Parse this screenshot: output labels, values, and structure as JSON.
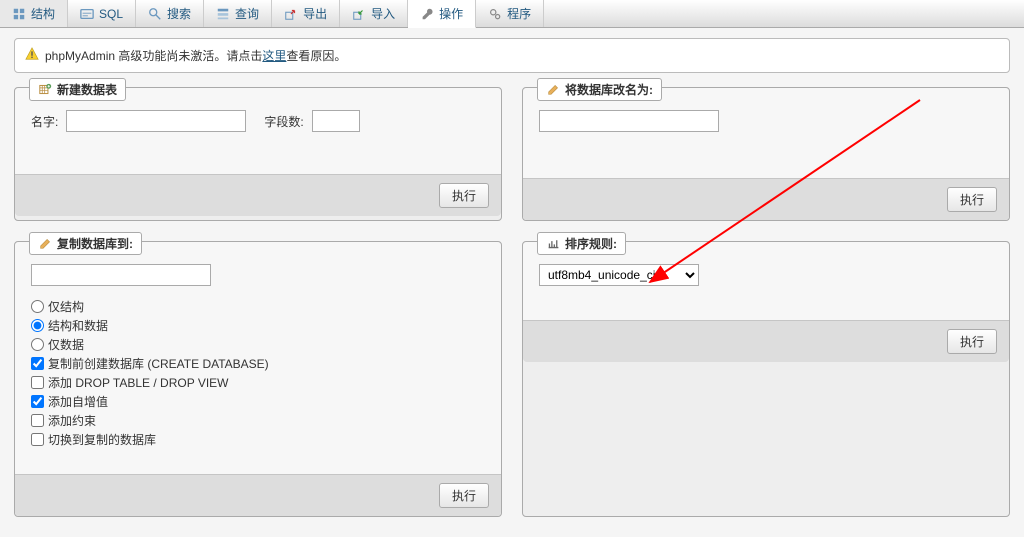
{
  "tabs": {
    "structure": "结构",
    "sql": "SQL",
    "search": "搜索",
    "query": "查询",
    "export": "导出",
    "import": "导入",
    "operations": "操作",
    "routines": "程序"
  },
  "warning": {
    "prefix": "phpMyAdmin 高级功能尚未激活。请点击",
    "link": "这里",
    "suffix": "查看原因。"
  },
  "panels": {
    "create_table": {
      "title": "新建数据表",
      "name_label": "名字:",
      "fields_label": "字段数:",
      "submit": "执行"
    },
    "rename_db": {
      "title": "将数据库改名为:",
      "submit": "执行"
    },
    "copy_db": {
      "title": "复制数据库到:",
      "opt_structure_only": "仅结构",
      "opt_structure_data": "结构和数据",
      "opt_data_only": "仅数据",
      "opt_create_before": "复制前创建数据库 (CREATE DATABASE)",
      "opt_add_drop": "添加 DROP TABLE / DROP VIEW",
      "opt_auto_increment": "添加自增值",
      "opt_add_constraints": "添加约束",
      "opt_switch": "切换到复制的数据库",
      "submit": "执行"
    },
    "collation": {
      "title": "排序规则:",
      "selected": "utf8mb4_unicode_ci",
      "submit": "执行"
    }
  }
}
